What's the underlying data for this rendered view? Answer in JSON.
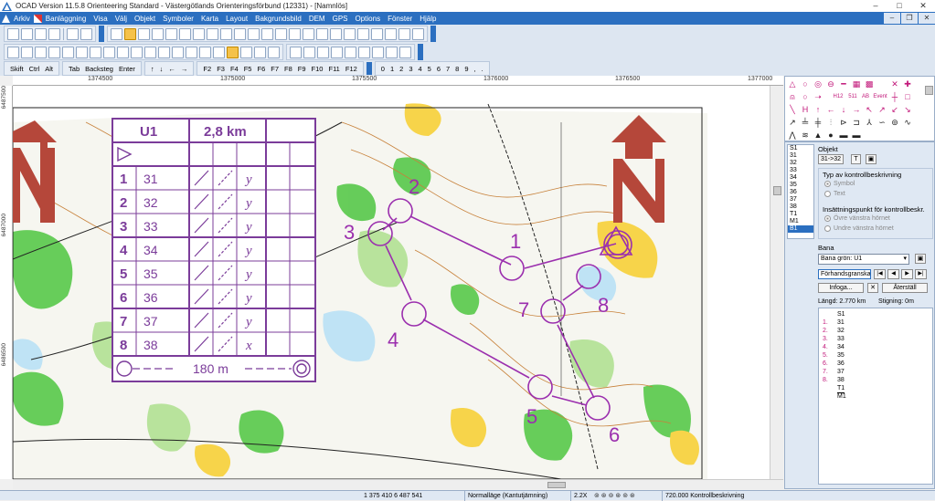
{
  "app": {
    "title": "OCAD Version 11.5.8  Orienteering Standard - Västergötlands Orienteringsförbund (12331) - [Namnlös]"
  },
  "window_controls": [
    "–",
    "□",
    "✕"
  ],
  "doc_controls": [
    "–",
    "❐",
    "✕"
  ],
  "menu": [
    "Arkiv",
    "Banläggning",
    "Visa",
    "Välj",
    "Objekt",
    "Symboler",
    "Karta",
    "Layout",
    "Bakgrundsbild",
    "DEM",
    "GPS",
    "Options",
    "Fönster",
    "Hjälp"
  ],
  "keyboard_row": {
    "keys_a": [
      "Skift",
      "Ctrl",
      "Alt"
    ],
    "keys_b": [
      "Tab",
      "Backsteg",
      "Enter"
    ],
    "arrows": [
      "↑",
      "↓",
      "←",
      "→"
    ],
    "fkeys": [
      "F2",
      "F3",
      "F4",
      "F5",
      "F6",
      "F7",
      "F8",
      "F9",
      "F10",
      "F11",
      "F12"
    ],
    "digits": [
      "0",
      "1",
      "2",
      "3",
      "4",
      "5",
      "6",
      "7",
      "8",
      "9",
      ",",
      "."
    ]
  },
  "ruler": {
    "top": [
      "1374500",
      "1375000",
      "1375500",
      "1376000",
      "1376500",
      "1377000"
    ],
    "left": [
      "6487500",
      "6487000",
      "6486500"
    ]
  },
  "map": {
    "control_labels": [
      "1",
      "2",
      "3",
      "4",
      "5",
      "6",
      "7",
      "8"
    ],
    "colors": {
      "course": "#9b2fae",
      "north_arrow": "#b5473a",
      "forest": "#3fbf2f",
      "open": "#f7d44a"
    }
  },
  "description_sheet": {
    "title": "U1",
    "length": "2,8 km",
    "rows": [
      {
        "n": "1",
        "code": "31",
        "sym": "y"
      },
      {
        "n": "2",
        "code": "32",
        "sym": "y"
      },
      {
        "n": "3",
        "code": "33",
        "sym": "y"
      },
      {
        "n": "4",
        "code": "34",
        "sym": "y"
      },
      {
        "n": "5",
        "code": "35",
        "sym": "y"
      },
      {
        "n": "6",
        "code": "36",
        "sym": "y"
      },
      {
        "n": "7",
        "code": "37",
        "sym": "y"
      },
      {
        "n": "8",
        "code": "38",
        "sym": "x"
      }
    ],
    "finish": "180 m"
  },
  "symbol_box": {
    "labels": [
      "H12",
      "511",
      "AB",
      "Event"
    ]
  },
  "course_panel": {
    "list": [
      "S1",
      "31",
      "32",
      "33",
      "34",
      "35",
      "36",
      "37",
      "38",
      "T1",
      "M1",
      "B1"
    ],
    "selected_index": 11,
    "objekt_title": "Objekt",
    "objekt_button": "31->32",
    "t_button": "T",
    "desc_type_title": "Typ av kontrollbeskrivning",
    "desc_type_options": [
      "Symbol",
      "Text"
    ],
    "insertion_title": "Insättningspunkt för kontrollbeskr.",
    "insertion_options": [
      "Övre vänstra hörnet",
      "Undre vänstra hörnet"
    ],
    "bana_title": "Bana",
    "bana_value": "Bana grön: U1",
    "preview": "Förhandsgranska",
    "nav": [
      "|◀",
      "◀",
      "▶",
      "▶|"
    ],
    "insert_button": "Infoga...",
    "delete_button": "✕",
    "reset_button": "Återställ",
    "length": "Längd: 2.770 km",
    "climb": "Stigning: 0m",
    "controls": [
      {
        "num": "",
        "code": "S1"
      },
      {
        "num": "1.",
        "code": "31"
      },
      {
        "num": "2.",
        "code": "32"
      },
      {
        "num": "3.",
        "code": "33"
      },
      {
        "num": "4.",
        "code": "34"
      },
      {
        "num": "5.",
        "code": "35"
      },
      {
        "num": "6.",
        "code": "36"
      },
      {
        "num": "7.",
        "code": "37"
      },
      {
        "num": "8.",
        "code": "38"
      },
      {
        "num": "",
        "code": "T1"
      },
      {
        "num": "",
        "code": "M1"
      }
    ]
  },
  "status": {
    "coords": "1 375 410  6 487 541",
    "mode": "Normalläge (Kantutjämning)",
    "zoom": "2.2X",
    "scale": "720.000 Kontrollbeskrivning"
  }
}
